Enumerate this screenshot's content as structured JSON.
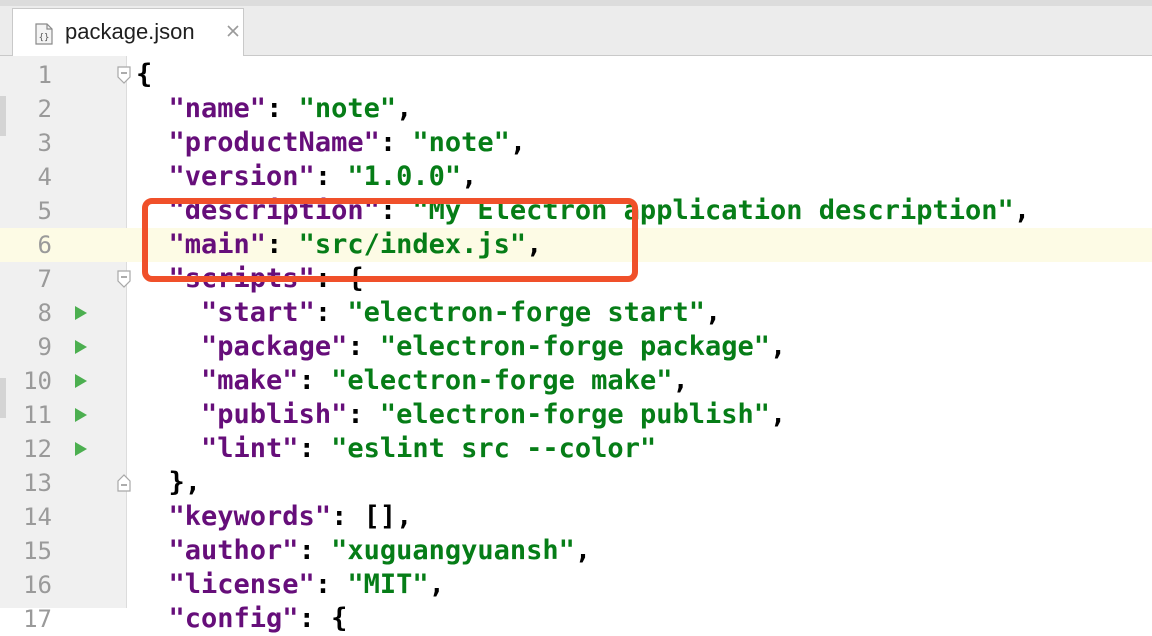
{
  "tab": {
    "title": "package.json",
    "icon": "json-file-icon",
    "close_icon": "close-icon"
  },
  "colors": {
    "key": "#660e7a",
    "string": "#067d17",
    "highlight": "#f0502a",
    "current_line": "#fdfbe5"
  },
  "editor": {
    "current_line": "6",
    "lines": [
      {
        "n": "1",
        "indent": "",
        "open": "{"
      },
      {
        "n": "2",
        "indent": "  ",
        "key": "\"name\"",
        "sep": ": ",
        "val": "\"note\"",
        "tail": ","
      },
      {
        "n": "3",
        "indent": "  ",
        "key": "\"productName\"",
        "sep": ": ",
        "val": "\"note\"",
        "tail": ","
      },
      {
        "n": "4",
        "indent": "  ",
        "key": "\"version\"",
        "sep": ": ",
        "val": "\"1.0.0\"",
        "tail": ","
      },
      {
        "n": "5",
        "indent": "  ",
        "key": "\"description\"",
        "sep": ": ",
        "val": "\"My Electron application description\"",
        "tail": ","
      },
      {
        "n": "6",
        "indent": "  ",
        "key": "\"main\"",
        "sep": ": ",
        "val": "\"src/index.js\"",
        "tail": ","
      },
      {
        "n": "7",
        "indent": "  ",
        "key": "\"scripts\"",
        "sep": ": ",
        "tail": "{"
      },
      {
        "n": "8",
        "indent": "    ",
        "key": "\"start\"",
        "sep": ": ",
        "val": "\"electron-forge start\"",
        "tail": ","
      },
      {
        "n": "9",
        "indent": "    ",
        "key": "\"package\"",
        "sep": ": ",
        "val": "\"electron-forge package\"",
        "tail": ","
      },
      {
        "n": "10",
        "indent": "    ",
        "key": "\"make\"",
        "sep": ": ",
        "val": "\"electron-forge make\"",
        "tail": ","
      },
      {
        "n": "11",
        "indent": "    ",
        "key": "\"publish\"",
        "sep": ": ",
        "val": "\"electron-forge publish\"",
        "tail": ","
      },
      {
        "n": "12",
        "indent": "    ",
        "key": "\"lint\"",
        "sep": ": ",
        "val": "\"eslint src --color\""
      },
      {
        "n": "13",
        "indent": "  ",
        "tail": "},"
      },
      {
        "n": "14",
        "indent": "  ",
        "key": "\"keywords\"",
        "sep": ": ",
        "tail": "[],"
      },
      {
        "n": "15",
        "indent": "  ",
        "key": "\"author\"",
        "sep": ": ",
        "val": "\"xuguangyuansh\"",
        "tail": ","
      },
      {
        "n": "16",
        "indent": "  ",
        "key": "\"license\"",
        "sep": ": ",
        "val": "\"MIT\"",
        "tail": ","
      },
      {
        "n": "17",
        "indent": "  ",
        "key": "\"config\"",
        "sep": ": ",
        "tail": "{"
      }
    ]
  }
}
